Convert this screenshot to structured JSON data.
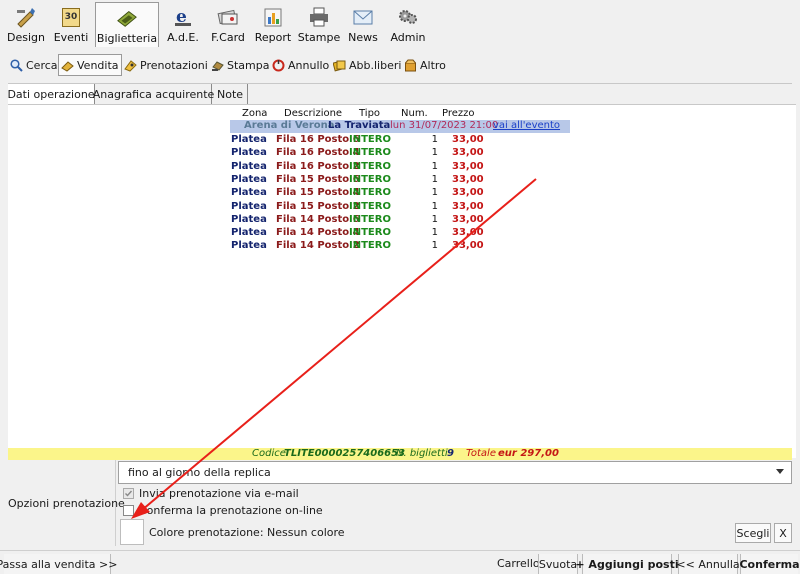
{
  "toolbar": {
    "items": [
      {
        "label": "Design",
        "icon": "design-icon"
      },
      {
        "label": "Eventi",
        "icon": "calendar-icon"
      },
      {
        "label": "Biglietteria",
        "icon": "ticket-office-icon"
      },
      {
        "label": "A.d.E.",
        "icon": "ade-icon"
      },
      {
        "label": "F.Card",
        "icon": "card-icon"
      },
      {
        "label": "Report",
        "icon": "report-chart-icon"
      },
      {
        "label": "Stampe",
        "icon": "printer-icon"
      },
      {
        "label": "News",
        "icon": "envelope-icon"
      },
      {
        "label": "Admin",
        "icon": "admin-gears-icon"
      }
    ],
    "active": "Biglietteria",
    "calendar_day": "30"
  },
  "subbar": {
    "items": [
      {
        "label": "Cerca",
        "icon": "search-icon"
      },
      {
        "label": "Vendita",
        "icon": "hand-ticket-icon"
      },
      {
        "label": "Prenotazioni",
        "icon": "booking-icon"
      },
      {
        "label": "Stampa",
        "icon": "stamp-icon"
      },
      {
        "label": "Annullo",
        "icon": "cancel-icon"
      },
      {
        "label": "Abb.liberi",
        "icon": "subscription-icon"
      },
      {
        "label": "Altro",
        "icon": "box-icon"
      }
    ],
    "active": "Vendita"
  },
  "tabs": [
    "Dati operazione",
    "Anagrafica acquirente",
    "Note"
  ],
  "table": {
    "headers": {
      "zona": "Zona",
      "descrizione": "Descrizione",
      "tipo": "Tipo",
      "num": "Num.",
      "prezzo": "Prezzo"
    },
    "event": {
      "venue": "Arena di Verona",
      "title": "La Traviata",
      "date": "lun 31/07/2023 21:00",
      "link": "vai all'evento"
    },
    "rows": [
      {
        "zona": "Platea",
        "descrizione": "Fila 16 Posto 6",
        "tipo": "INTERO",
        "num": "1",
        "prezzo": "33,00"
      },
      {
        "zona": "Platea",
        "descrizione": "Fila 16 Posto 4",
        "tipo": "INTERO",
        "num": "1",
        "prezzo": "33,00"
      },
      {
        "zona": "Platea",
        "descrizione": "Fila 16 Posto 2",
        "tipo": "INTERO",
        "num": "1",
        "prezzo": "33,00"
      },
      {
        "zona": "Platea",
        "descrizione": "Fila 15 Posto 6",
        "tipo": "INTERO",
        "num": "1",
        "prezzo": "33,00"
      },
      {
        "zona": "Platea",
        "descrizione": "Fila 15 Posto 4",
        "tipo": "INTERO",
        "num": "1",
        "prezzo": "33,00"
      },
      {
        "zona": "Platea",
        "descrizione": "Fila 15 Posto 2",
        "tipo": "INTERO",
        "num": "1",
        "prezzo": "33,00"
      },
      {
        "zona": "Platea",
        "descrizione": "Fila 14 Posto 6",
        "tipo": "INTERO",
        "num": "1",
        "prezzo": "33,00"
      },
      {
        "zona": "Platea",
        "descrizione": "Fila 14 Posto 4",
        "tipo": "INTERO",
        "num": "1",
        "prezzo": "33,00"
      },
      {
        "zona": "Platea",
        "descrizione": "Fila 14 Posto 2",
        "tipo": "INTERO",
        "num": "1",
        "prezzo": "33,00"
      }
    ]
  },
  "summary": {
    "codice_label": "Codice",
    "codice": "TLITE0000257406653",
    "nbiglietti_label": "N. biglietti",
    "nbiglietti": "9",
    "totale_label": "Totale",
    "totale": "eur 297,00"
  },
  "options": {
    "label": "Opzioni prenotazione",
    "replica_select": "fino al giorno della replica",
    "email_checkbox": {
      "label": "Invia prenotazione via e-mail",
      "checked": true
    },
    "online_checkbox": {
      "label": "Conferma la prenotazione on-line",
      "checked": false
    },
    "colore_label": "Colore prenotazione: Nessun colore",
    "scegli": "Scegli",
    "clear": "X"
  },
  "bottom": {
    "passa": "Passa alla vendita >>",
    "carrello": "Carrello",
    "svuota": "Svuota",
    "aggiungi": "+ Aggiungi posti",
    "annulla": "<< Annulla",
    "conferma": "Conferma"
  },
  "colors": {
    "zona": "#14246e",
    "descrizione": "#8b1a1a",
    "tipo": "#1b8a1b",
    "prezzo": "#c41515",
    "event_band": "#b8c8e8",
    "summary_band": "#fbf58a",
    "annotation_arrow": "#e8201a"
  }
}
